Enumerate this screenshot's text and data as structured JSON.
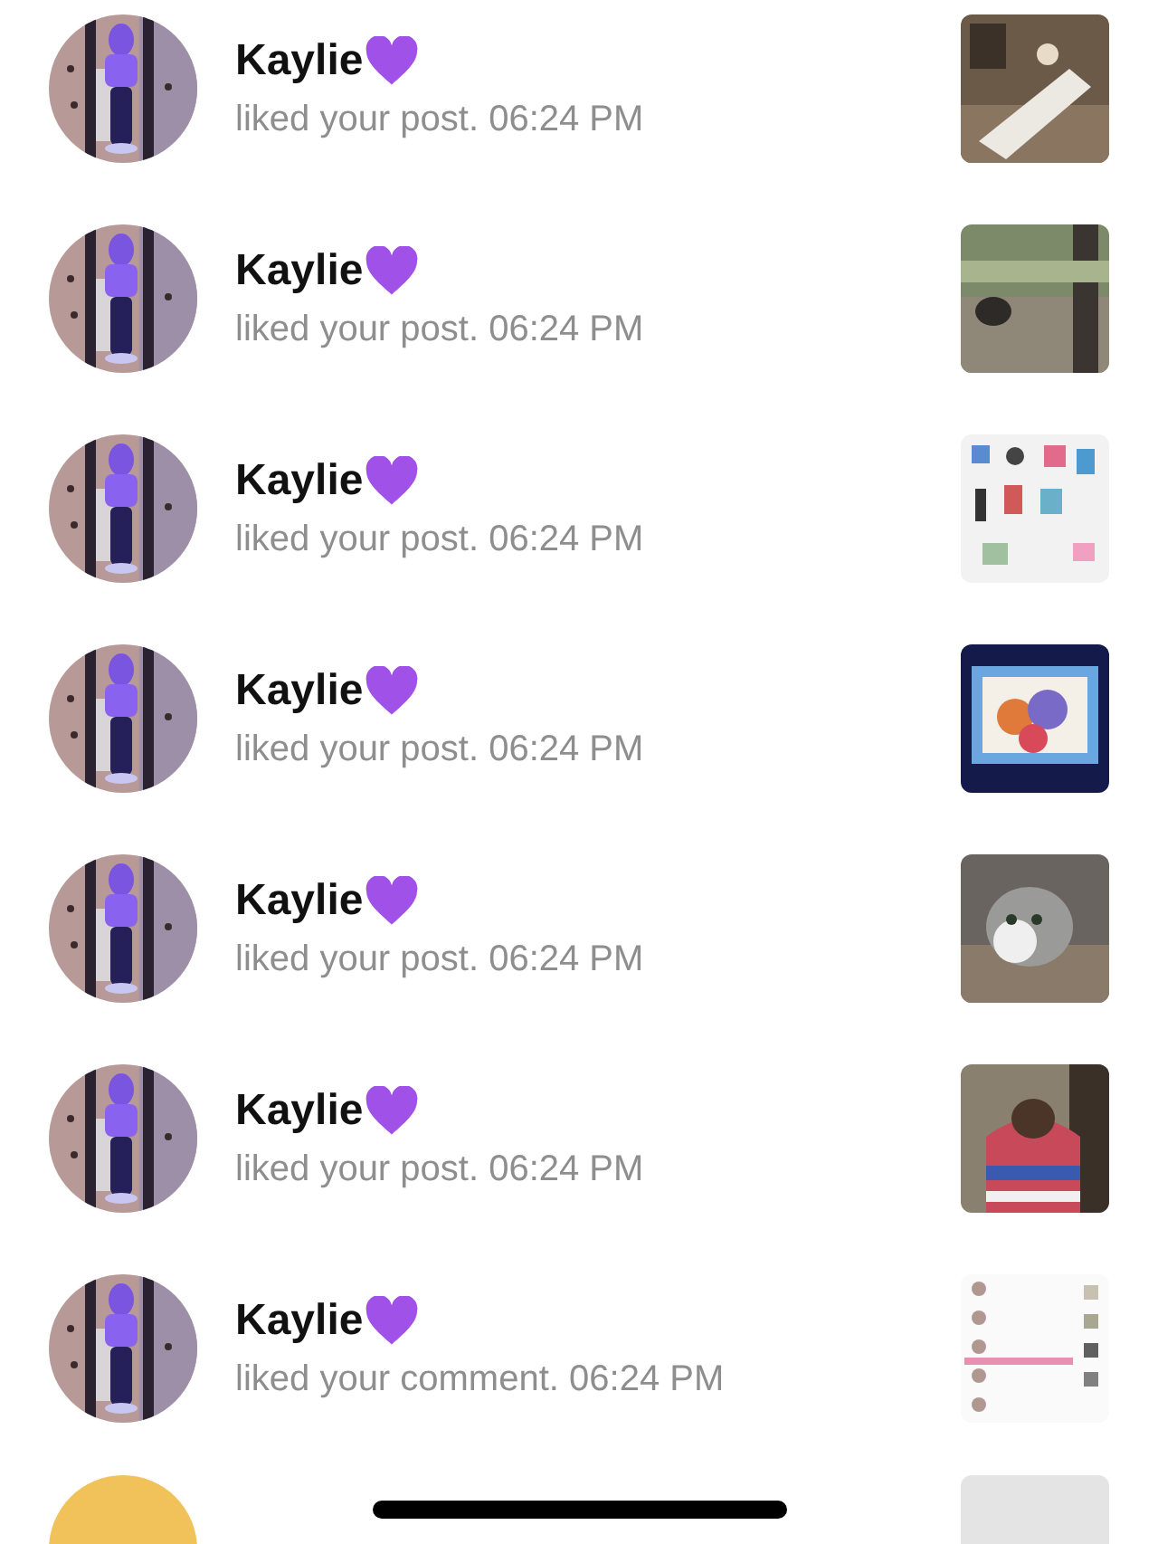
{
  "notifications": [
    {
      "kind": "notification",
      "name": "Kaylie",
      "message": "liked your post. 06:24 PM"
    },
    {
      "kind": "notification",
      "name": "Kaylie",
      "message": "liked your post. 06:24 PM"
    },
    {
      "kind": "notification",
      "name": "Kaylie",
      "message": "liked your post. 06:24 PM"
    },
    {
      "kind": "notification",
      "name": "Kaylie",
      "message": "liked your post. 06:24 PM"
    },
    {
      "kind": "notification",
      "name": "Kaylie",
      "message": "liked your post. 06:24 PM"
    },
    {
      "kind": "notification",
      "name": "Kaylie",
      "message": "liked your post. 06:24 PM"
    },
    {
      "kind": "notification",
      "name": "Kaylie",
      "message": "liked your comment. 06:24 PM"
    },
    {
      "kind": "cut_off"
    }
  ]
}
